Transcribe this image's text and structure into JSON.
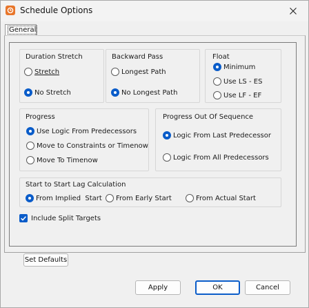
{
  "window": {
    "title": "Schedule Options",
    "icon": "schedule-app-icon",
    "close_icon": "close-icon"
  },
  "tabs": [
    {
      "label": "General",
      "selected": true
    }
  ],
  "duration_stretch": {
    "title": "Duration Stretch",
    "options": [
      {
        "label": "Stretch",
        "checked": false
      },
      {
        "label": "No Stretch",
        "checked": true
      }
    ]
  },
  "backward_pass": {
    "title": "Backward Pass",
    "options": [
      {
        "label": "Longest Path",
        "checked": false
      },
      {
        "label": "No Longest Path",
        "checked": true
      }
    ]
  },
  "float": {
    "title": "Float",
    "options": [
      {
        "label": "Minimum",
        "checked": true
      },
      {
        "label": "Use LS - ES",
        "checked": false
      },
      {
        "label": "Use LF - EF",
        "checked": false
      }
    ]
  },
  "progress": {
    "title": "Progress",
    "options": [
      {
        "label": "Use Logic From Predecessors",
        "checked": true
      },
      {
        "label": "Move to Constraints or Timenow",
        "checked": false
      },
      {
        "label": "Move To Timenow",
        "checked": false
      }
    ]
  },
  "progress_out_of_sequence": {
    "title": "Progress Out Of Sequence",
    "options": [
      {
        "label": "Logic From Last Predecessor",
        "checked": true
      },
      {
        "label": "Logic From All Predecessors",
        "checked": false
      }
    ]
  },
  "start_to_start_lag": {
    "title": "Start to Start Lag Calculation",
    "options": [
      {
        "label": "From Implied  Start",
        "checked": true
      },
      {
        "label": "From Early Start",
        "checked": false
      },
      {
        "label": "From Actual Start",
        "checked": false
      }
    ]
  },
  "include_split_targets": {
    "label": "Include Split Targets",
    "checked": true
  },
  "buttons": {
    "set_defaults": "Set Defaults",
    "apply": "Apply",
    "ok": "OK",
    "cancel": "Cancel"
  },
  "colors": {
    "accent": "#0a5cc9",
    "app_icon": "#e8762b",
    "dialog_background": "#f0f0f0"
  }
}
